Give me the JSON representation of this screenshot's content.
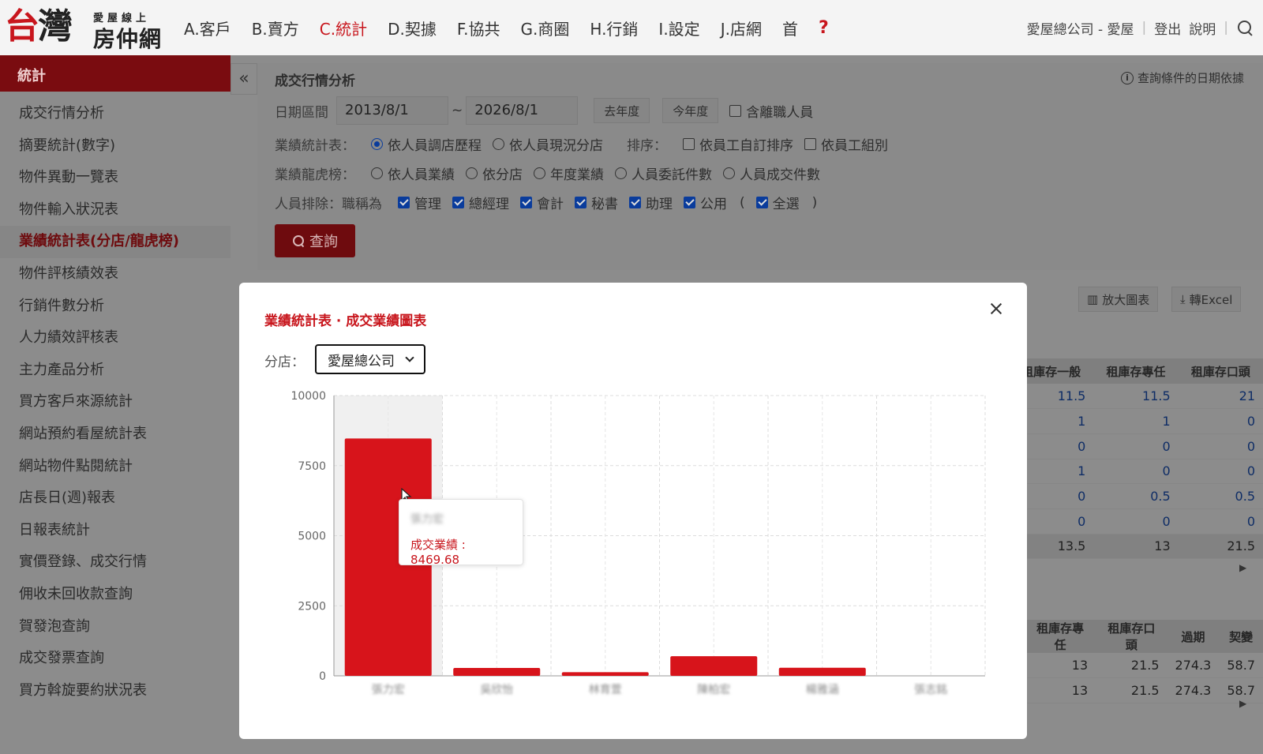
{
  "header": {
    "logo_char1": "台",
    "logo_char2": "灣",
    "logo_sub": "愛屋線上",
    "logo_name": "房仲網",
    "nav": [
      "A.客戶",
      "B.賣方",
      "C.統計",
      "D.契據",
      "F.協共",
      "G.商圈",
      "H.行銷",
      "I.設定",
      "J.店網",
      "首"
    ],
    "nav_active": 2,
    "help": "?",
    "company": "愛屋總公司 - 愛屋",
    "logout": "登出",
    "explain": "說明"
  },
  "sidebar": {
    "title": "統計",
    "collapse": "«",
    "items": [
      "成交行情分析",
      "摘要統計(數字)",
      "物件異動一覽表",
      "物件輸入狀況表",
      "業績統計表(分店/龍虎榜)",
      "物件評核績效表",
      "行銷件數分析",
      "人力績效評核表",
      "主力產品分析",
      "買方客戶來源統計",
      "網站預約看屋統計表",
      "網站物件點閱統計",
      "店長日(週)報表",
      "日報表統計",
      "實價登錄、成交行情",
      "佣收未回收款查詢",
      "賀發泡查詢",
      "成交發票查詢",
      "買方斡旋要約狀況表"
    ],
    "active": 4
  },
  "form": {
    "title": "成交行情分析",
    "date_hint": "查詢條件的日期依據",
    "date_label": "日期區間",
    "date_from": "2013/8/1",
    "tilde": "~",
    "date_to": "2026/8/1",
    "last_year": "去年度",
    "this_year": "今年度",
    "include_resigned": "含離職人員",
    "perf_label": "業績統計表：",
    "perf_opt1": "依人員調店歷程",
    "perf_opt2": "依人員現況分店",
    "sort_label": "排序：",
    "sort_opt1": "依員工自訂排序",
    "sort_opt2": "依員工組別",
    "rank_label": "業績龍虎榜：",
    "rank_opts": [
      "依人員業績",
      "依分店",
      "年度業績",
      "人員委託件數",
      "人員成交件數"
    ],
    "exclude_label": "人員排除：職稱為",
    "exclude_opts": [
      "管理",
      "總經理",
      "會計",
      "秘書",
      "助理",
      "公用"
    ],
    "paren_open": "(",
    "select_all": "全選",
    "paren_close": ")",
    "query": "查詢"
  },
  "toolbar": {
    "enlarge": "放大圖表",
    "excel": "轉Excel"
  },
  "table1": {
    "headers": [
      "租庫存一般",
      "租庫存專任",
      "租庫存口頭"
    ],
    "rows": [
      [
        "11.5",
        "11.5",
        "21"
      ],
      [
        "1",
        "1",
        "0"
      ],
      [
        "0",
        "0",
        "0"
      ],
      [
        "1",
        "0",
        "0"
      ],
      [
        "0",
        "0.5",
        "0.5"
      ],
      [
        "0",
        "0",
        "0"
      ]
    ],
    "total": [
      "13.5",
      "13",
      "21.5"
    ]
  },
  "table2": {
    "headers": [
      "租庫存專任",
      "租庫存口頭",
      "過期",
      "契變"
    ],
    "rows": [
      [
        "13",
        "21.5",
        "274.3",
        "58.7"
      ],
      [
        "13",
        "21.5",
        "274.3",
        "58.7"
      ]
    ]
  },
  "modal": {
    "title": "業績統計表 · 成交業績圖表",
    "branch_label": "分店：",
    "branch_value": "愛屋總公司",
    "tooltip_name": "張力宏",
    "tooltip_value": "成交業績 : 8469.68"
  },
  "colors": {
    "bar": "#d7141b",
    "accent": "#c8161d"
  },
  "chart_data": {
    "type": "bar",
    "categories": [
      "張力宏",
      "吳欣怡",
      "林育萱",
      "陳柏宏",
      "楊雅涵",
      "張志銘"
    ],
    "categories_blurred": true,
    "series": [
      {
        "values": [
          8469.68,
          280,
          130,
          700,
          290,
          0
        ]
      }
    ],
    "ylim": [
      0,
      10000
    ],
    "yticks": [
      0,
      2500,
      5000,
      7500,
      10000
    ],
    "grid": true,
    "highlight_index": 0
  }
}
